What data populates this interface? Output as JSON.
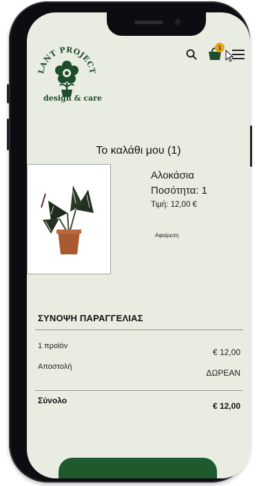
{
  "brand": {
    "arc_text": "PLANT PROJECTS",
    "tagline": "design & care",
    "logo_color": "#1d4d2a"
  },
  "header": {
    "icons": [
      "search-icon",
      "cart-icon",
      "menu-icon"
    ],
    "cart_count": "1",
    "badge_color": "#e5a51c"
  },
  "cart": {
    "title": "Το καλάθι μου (1)",
    "item": {
      "name": "Αλοκάσια",
      "quantity": "Ποσότητα: 1",
      "price": "Τιμή: 12,00 €",
      "remove": "Αφαίρεση",
      "image": "plant-photo"
    }
  },
  "summary": {
    "title": "ΣΥΝΟΨΗ ΠΑΡΑΓΓΕΛΙΑΣ",
    "rows": [
      {
        "label": "1 προϊόν",
        "value": "€ 12,00"
      },
      {
        "label": "Αποστολή",
        "value": "ΔΩΡΕΑΝ"
      }
    ],
    "total": {
      "label": "Σύνολο",
      "value": "€ 12,00"
    }
  },
  "colors": {
    "screen_bg": "#e8ece1",
    "accent": "#1f5a2e"
  }
}
